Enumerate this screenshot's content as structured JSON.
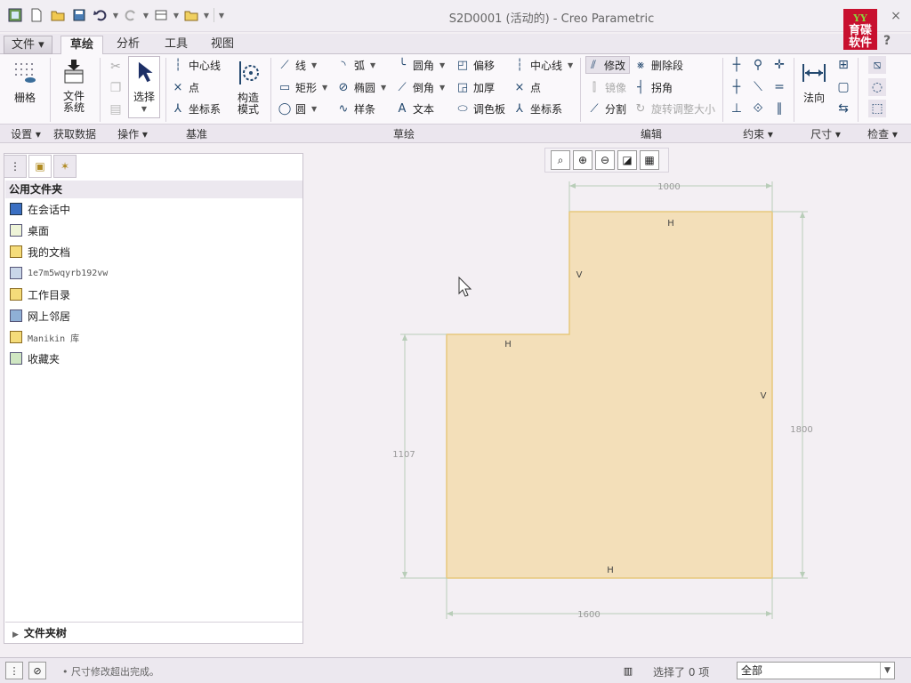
{
  "app": {
    "title": "S2D0001 (活动的) - Creo Parametric",
    "logo_top": "育碟",
    "logo_bottom": "软件",
    "logo_mark": "YY",
    "window_buttons": [
      "?",
      "×"
    ]
  },
  "tabs": [
    {
      "label": "文件 ▾"
    },
    {
      "label": "草绘"
    },
    {
      "label": "分析"
    },
    {
      "label": "工具"
    },
    {
      "label": "视图"
    }
  ],
  "ribbon": {
    "settings": {
      "grid_label": "栅格",
      "group": "设置 ▾"
    },
    "get_data": {
      "file_system_label": "文件\n系统",
      "group": "获取数据"
    },
    "operations": {
      "select_label": "选择",
      "group": "操作 ▾"
    },
    "datum": {
      "centerline": "中心线",
      "point": "点",
      "csys": "坐标系",
      "construct_mode": "构造\n模式",
      "group": "基准"
    },
    "sketching": {
      "line": "线",
      "rectangle": "矩形",
      "circle": "圆",
      "arc": "弧",
      "ellipse": "椭圆",
      "spline": "样条",
      "fillet": "圆角",
      "chamfer": "倒角",
      "text": "文本",
      "offset": "偏移",
      "thicken": "加厚",
      "palette": "调色板",
      "centerline": "中心线",
      "point": "点",
      "csys": "坐标系",
      "group": "草绘"
    },
    "editing": {
      "modify": "修改",
      "delete_segment": "删除段",
      "mirror": "镜像",
      "corner": "拐角",
      "divide": "分割",
      "rotate_resize": "旋转调整大小",
      "group": "编辑"
    },
    "constrain": {
      "group": "约束 ▾"
    },
    "dimension": {
      "normal_label": "法向",
      "group": "尺寸 ▾"
    },
    "inspect": {
      "group": "检查 ▾"
    }
  },
  "navigator": {
    "header": "公用文件夹",
    "items": [
      {
        "label": "在会话中",
        "icon": "session-icon"
      },
      {
        "label": "桌面",
        "icon": "desktop-icon"
      },
      {
        "label": "我的文档",
        "icon": "documents-icon"
      },
      {
        "label": "1e7m5wqyrb192vw",
        "icon": "computer-icon"
      },
      {
        "label": "工作目录",
        "icon": "working-dir-icon"
      },
      {
        "label": "网上邻居",
        "icon": "network-icon"
      },
      {
        "label": "Manikin 库",
        "icon": "library-icon"
      },
      {
        "label": "收藏夹",
        "icon": "favorites-icon"
      }
    ],
    "footer": "文件夹树"
  },
  "sketch": {
    "fill_color": "#f3dfb9",
    "edge_color": "#e8c97c",
    "dimensions": {
      "top": "1000",
      "right": "1800",
      "left": "1107",
      "bottom": "1600"
    },
    "constraints": {
      "h": "H",
      "v": "V"
    }
  },
  "status": {
    "message": "• 尺寸修改超出完成。",
    "filter_label": "选择了 0 项",
    "filter_value": "全部"
  }
}
